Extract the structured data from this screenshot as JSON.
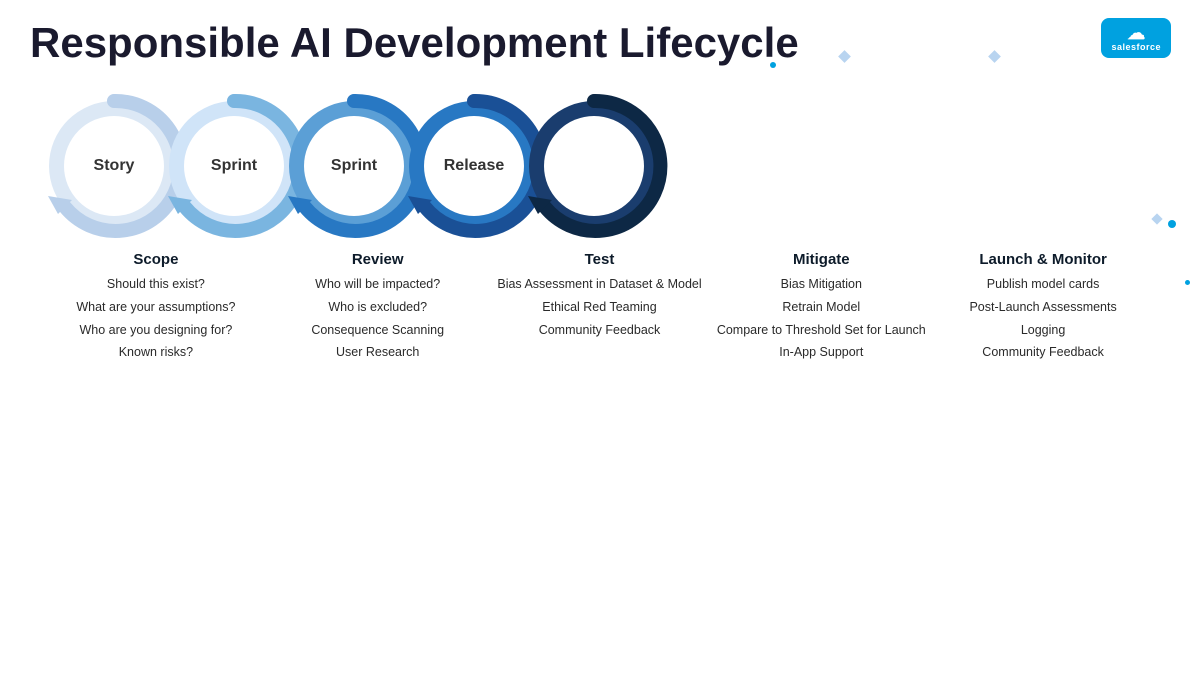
{
  "page": {
    "title": "Responsible AI Development Lifecycle",
    "background": "#ffffff"
  },
  "logo": {
    "text": "salesforce"
  },
  "circles": [
    {
      "label": "Story",
      "color_ring": "#c8ddf0",
      "color_fill": "#e8f2fb",
      "type": "light"
    },
    {
      "label": "Sprint",
      "color_ring": "#a0c4e8",
      "color_fill": "#d0e6f7",
      "type": "medium-light"
    },
    {
      "label": "Sprint",
      "color_ring": "#2b7fd4",
      "color_fill": "#5ba3e0",
      "type": "medium"
    },
    {
      "label": "Release",
      "color_ring": "#1a5fb4",
      "color_fill": "#2b7fd4",
      "type": "dark"
    },
    {
      "label": "",
      "color_ring": "#0d2e5a",
      "color_fill": "#1a3d6e",
      "type": "darkest"
    }
  ],
  "phases": [
    {
      "title": "Scope",
      "items": [
        "Should this exist?",
        "What are your assumptions?",
        "Who are you designing for?",
        "Known risks?"
      ]
    },
    {
      "title": "Review",
      "items": [
        "Who will be impacted?",
        "Who is excluded?",
        "Consequence Scanning",
        "User Research"
      ]
    },
    {
      "title": "Test",
      "items": [
        "Bias Assessment in Dataset & Model",
        "Ethical Red Teaming",
        "Community Feedback"
      ]
    },
    {
      "title": "Mitigate",
      "items": [
        "Bias Mitigation",
        "Retrain Model",
        "Compare to Threshold Set for Launch",
        "In-App Support"
      ]
    },
    {
      "title": "Launch & Monitor",
      "items": [
        "Publish model cards",
        "Post-Launch Assessments",
        "Logging",
        "Community Feedback"
      ]
    }
  ]
}
